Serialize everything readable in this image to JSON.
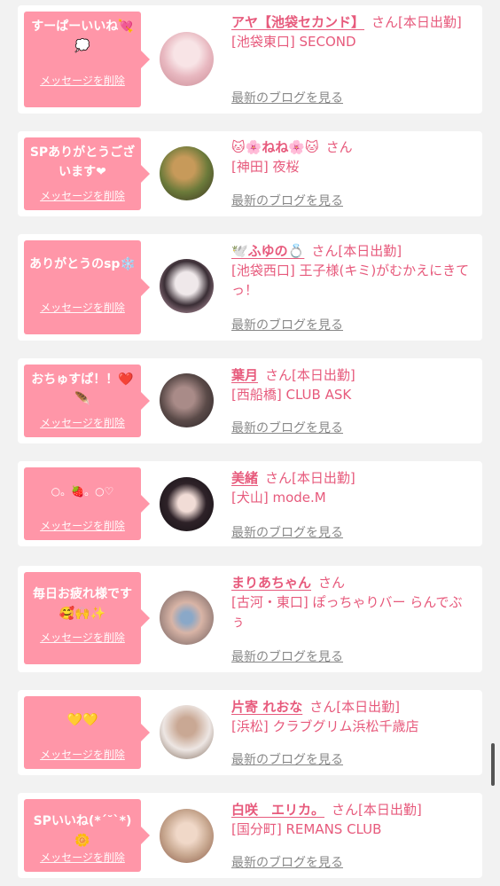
{
  "delete_label": "メッセージを削除",
  "blog_label": "最新のブログを見る",
  "san": "さん",
  "today_label": "[本日出勤]",
  "cards": [
    {
      "message": "すーぱーいいね💘💭",
      "name": "アヤ【池袋セカンド】",
      "shop": "[池袋東口] SECOND",
      "today": "[本日出勤]",
      "avatar_colors": [
        "#f8e4e6",
        "#e8b8c0",
        "#c98a94"
      ]
    },
    {
      "message": "SPありがとうございます❤",
      "name": "🐱🌸ねね🌸🐱",
      "shop": "[神田] 夜桜",
      "today": "",
      "avatar_colors": [
        "#6b7a3a",
        "#c79a5a",
        "#3a3020"
      ]
    },
    {
      "message": "ありがとうのsp❄️",
      "name": "🕊️ふゆの💍",
      "shop": "[池袋西口] 王子様(キミ)がむかえにきてっ！",
      "today": "[本日出勤]",
      "avatar_colors": [
        "#efe8ea",
        "#3a2e35",
        "#d9b0bf"
      ]
    },
    {
      "message": "おちゅすぱ！！❤️🪶",
      "name": "葉月",
      "shop": "[西船橋] CLUB ASK",
      "today": "[本日出勤]",
      "avatar_colors": [
        "#2a2226",
        "#a98b88",
        "#5a4a48"
      ]
    },
    {
      "message": "○。🍓。○♡",
      "name": "美緒",
      "shop": "[犬山] mode.M",
      "today": "[本日出勤]",
      "avatar_colors": [
        "#141014",
        "#f1dcd6",
        "#2e2228"
      ]
    },
    {
      "message": "毎日お疲れ様です🥰🙌✨",
      "name": "まりあちゃん",
      "shop": "[古河・東口] ぽっちゃりバー らんでぶぅ",
      "today": "",
      "avatar_colors": [
        "#6a5a5a",
        "#d8b4a6",
        "#8aa8c8"
      ]
    },
    {
      "message": "💛💛",
      "name": "片寄 れおな",
      "shop": "[浜松] クラブグリム浜松千歳店",
      "today": "[本日出勤]",
      "avatar_colors": [
        "#ede6e3",
        "#c9a894",
        "#7a6454"
      ]
    },
    {
      "message": "SPいいね(*´˘`*)🌼",
      "name": "白咲　エリカ。",
      "shop": "[国分町] REMANS CLUB",
      "today": "[本日出勤]",
      "avatar_colors": [
        "#c8a890",
        "#f0d8c8",
        "#8a5a48"
      ]
    }
  ]
}
